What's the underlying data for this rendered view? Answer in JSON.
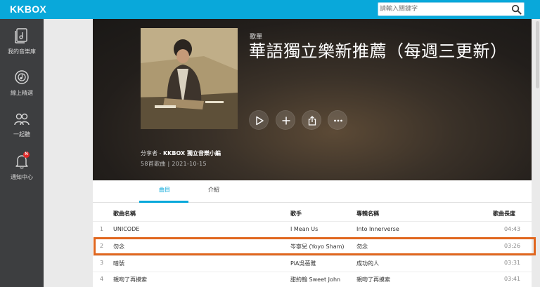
{
  "app": {
    "logo": "KKBOX"
  },
  "search": {
    "placeholder": "請輸入關鍵字"
  },
  "sidebar": {
    "items": [
      {
        "label": "我的音樂庫",
        "icon": "music-library-icon"
      },
      {
        "label": "線上精選",
        "icon": "featured-icon"
      },
      {
        "label": "一起聽",
        "icon": "listen-together-icon"
      },
      {
        "label": "通知中心",
        "icon": "bell-icon",
        "badge": "N"
      }
    ]
  },
  "playlist": {
    "type": "歌單",
    "title": "華語獨立樂新推薦（每週三更新）",
    "sharer_prefix": "分享者 - ",
    "sharer_name": "KKBOX 獨立音樂小編",
    "meta": "58首歌曲 | 2021-10-15"
  },
  "tabs": [
    {
      "label": "曲目",
      "active": true
    },
    {
      "label": "介紹",
      "active": false
    }
  ],
  "table": {
    "headers": {
      "song": "歌曲名稱",
      "artist": "歌手",
      "album": "專輯名稱",
      "duration": "歌曲長度"
    },
    "rows": [
      {
        "num": "1",
        "song": "UNICODE",
        "artist": "I Mean Us",
        "album": "Into Innerverse",
        "duration": "04:43"
      },
      {
        "num": "2",
        "song": "勿念",
        "artist": "岑寧兒 (Yoyo Sham)",
        "album": "勿念",
        "duration": "03:26"
      },
      {
        "num": "3",
        "song": "暗號",
        "artist": "PiA吳蓓雅",
        "album": "成功的人",
        "duration": "03:31"
      },
      {
        "num": "4",
        "song": "親吻了再摸索",
        "artist": "甜約翰 Sweet John",
        "album": "親吻了再摸索",
        "duration": "03:41"
      }
    ]
  },
  "colors": {
    "accent": "#09a8da",
    "sidebar": "#3d3e40",
    "highlight": "#e0671f"
  }
}
